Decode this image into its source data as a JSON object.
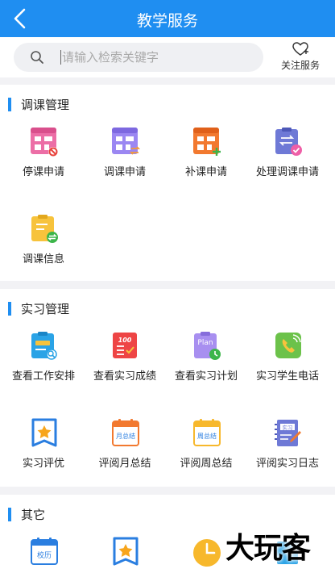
{
  "header": {
    "title": "教学服务"
  },
  "search": {
    "placeholder": "请输入检索关键字"
  },
  "follow": {
    "label": "关注服务"
  },
  "sections": [
    {
      "title": "调课管理",
      "items": [
        {
          "label": "停课申请",
          "icon": "stop-class-icon"
        },
        {
          "label": "调课申请",
          "icon": "adjust-class-icon"
        },
        {
          "label": "补课申请",
          "icon": "makeup-class-icon"
        },
        {
          "label": "处理调课申请",
          "icon": "process-adjust-icon"
        },
        {
          "label": "调课信息",
          "icon": "adjust-info-icon"
        }
      ]
    },
    {
      "title": "实习管理",
      "items": [
        {
          "label": "查看工作安排",
          "icon": "work-schedule-icon"
        },
        {
          "label": "查看实习成绩",
          "icon": "internship-score-icon"
        },
        {
          "label": "查看实习计划",
          "icon": "internship-plan-icon"
        },
        {
          "label": "实习学生电话",
          "icon": "student-phone-icon"
        },
        {
          "label": "实习评优",
          "icon": "internship-award-icon"
        },
        {
          "label": "评阅月总结",
          "icon": "monthly-summary-icon"
        },
        {
          "label": "评阅周总结",
          "icon": "weekly-summary-icon"
        },
        {
          "label": "评阅实习日志",
          "icon": "internship-log-icon"
        }
      ]
    },
    {
      "title": "其它",
      "items": [
        {
          "label": "校历",
          "icon": "school-calendar-icon"
        },
        {
          "label": "",
          "icon": "award-icon"
        },
        {
          "label": "",
          "icon": "clock-icon"
        },
        {
          "label": "",
          "icon": "edit-icon"
        }
      ]
    }
  ],
  "icon_text": {
    "score": "100",
    "plan": "Plan",
    "month": "月总结",
    "week": "周总结",
    "log": "实习",
    "calendar": "校历"
  },
  "watermark": "大玩客",
  "colors": {
    "brand": "#1f8ef1"
  }
}
